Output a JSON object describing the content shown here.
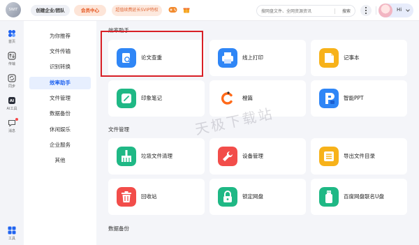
{
  "topbar": {
    "logo_text": "SWIT",
    "enterprise_label": "创建企业/团队",
    "vip_label": "会员中心",
    "promo_label": "超值续费延长SVIP特权",
    "search": {
      "placeholder": "搜网盘文件、全网资源资讯",
      "button": "搜索"
    },
    "greeting": "Hi"
  },
  "rail": {
    "items": [
      {
        "label": "首页",
        "icon": "home-icon"
      },
      {
        "label": "传输",
        "icon": "transfer-icon"
      },
      {
        "label": "同步",
        "icon": "sync-icon"
      },
      {
        "label": "AI工具",
        "icon": "ai-tool-icon"
      },
      {
        "label": "消息",
        "icon": "message-icon"
      }
    ],
    "bottom": {
      "label": "工具",
      "icon": "apps-icon"
    }
  },
  "nav": {
    "items": [
      "为你推荐",
      "文件传输",
      "识别转换",
      "效率助手",
      "文件管理",
      "数据备份",
      "休闲娱乐",
      "企业服务",
      "其他"
    ],
    "active_index": 3
  },
  "sections": [
    {
      "title": "效率助手",
      "cards": [
        {
          "label": "论文查重",
          "icon": "thesis-check-icon",
          "color": "#2f86f6"
        },
        {
          "label": "线上打印",
          "icon": "printer-icon",
          "color": "#2f86f6"
        },
        {
          "label": "记事本",
          "icon": "notepad-icon",
          "color": "#f7b21a"
        },
        {
          "label": "印象笔记",
          "icon": "evernote-icon",
          "color": "#1fb885"
        },
        {
          "label": "橙篇",
          "icon": "chengpian-icon",
          "color": "#ff6a1a"
        },
        {
          "label": "智能PPT",
          "icon": "smart-ppt-icon",
          "color": "#2f86f6"
        }
      ]
    },
    {
      "title": "文件管理",
      "cards": [
        {
          "label": "垃圾文件清理",
          "icon": "broom-icon",
          "color": "#1fb885"
        },
        {
          "label": "设备管理",
          "icon": "wrench-icon",
          "color": "#f24d4a"
        },
        {
          "label": "导出文件目录",
          "icon": "export-list-icon",
          "color": "#f7b21a"
        },
        {
          "label": "回收站",
          "icon": "trash-icon",
          "color": "#f24d4a"
        },
        {
          "label": "锁定网盘",
          "icon": "lock-icon",
          "color": "#1fb885"
        },
        {
          "label": "百度网盘联名U盘",
          "icon": "usb-drive-icon",
          "color": "#1fb885"
        }
      ]
    },
    {
      "title": "数据备份",
      "cards": []
    }
  ],
  "watermark": "天极下载站"
}
